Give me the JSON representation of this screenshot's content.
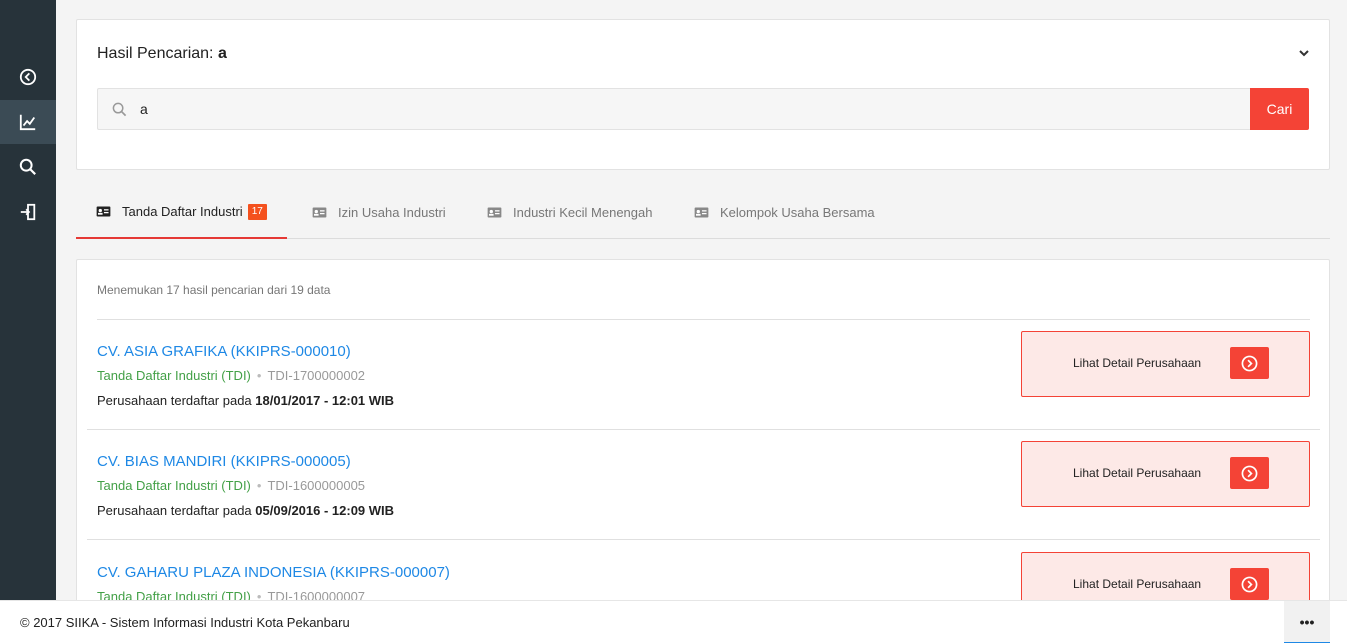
{
  "sidebar": {
    "items": [
      {
        "icon": "back-circle-icon",
        "active": false
      },
      {
        "icon": "chart-line-icon",
        "active": true
      },
      {
        "icon": "search-icon",
        "active": false
      },
      {
        "icon": "logout-icon",
        "active": false
      }
    ]
  },
  "search": {
    "title_prefix": "Hasil Pencarian:",
    "title_query": "a",
    "input_value": "a",
    "button_label": "Cari"
  },
  "tabs": [
    {
      "label": "Tanda Daftar Industri",
      "badge": "17",
      "active": true,
      "icon": "id-card-icon"
    },
    {
      "label": "Izin Usaha Industri",
      "active": false,
      "icon": "id-card-icon"
    },
    {
      "label": "Industri Kecil Menengah",
      "active": false,
      "icon": "id-card-icon"
    },
    {
      "label": "Kelompok Usaha Bersama",
      "active": false,
      "icon": "id-card-icon"
    }
  ],
  "results": {
    "summary": "Menemukan 17 hasil pencarian dari 19 data",
    "items": [
      {
        "name": "CV. ASIA GRAFIKA (KKIPRS-000010)",
        "type": "Tanda Daftar Industri (TDI)",
        "code": "TDI-1700000002",
        "registered_prefix": "Perusahaan terdaftar pada",
        "registered_date": "18/01/2017 - 12:01 WIB",
        "detail_label": "Lihat Detail Perusahaan"
      },
      {
        "name": "CV. BIAS MANDIRI (KKIPRS-000005)",
        "type": "Tanda Daftar Industri (TDI)",
        "code": "TDI-1600000005",
        "registered_prefix": "Perusahaan terdaftar pada",
        "registered_date": "05/09/2016 - 12:09 WIB",
        "detail_label": "Lihat Detail Perusahaan"
      },
      {
        "name": "CV. GAHARU PLAZA INDONESIA (KKIPRS-000007)",
        "type": "Tanda Daftar Industri (TDI)",
        "code": "TDI-1600000007",
        "registered_prefix": "",
        "registered_date": "",
        "detail_label": "Lihat Detail Perusahaan"
      }
    ]
  },
  "footer": {
    "copyright": "© 2017 SIIKA - Sistem Informasi Industri Kota Pekanbaru",
    "more_label": "•••"
  },
  "colors": {
    "accent": "#f44336",
    "link": "#1e88e5",
    "tdi_green": "#43a047",
    "sidebar_bg": "#27333a"
  }
}
